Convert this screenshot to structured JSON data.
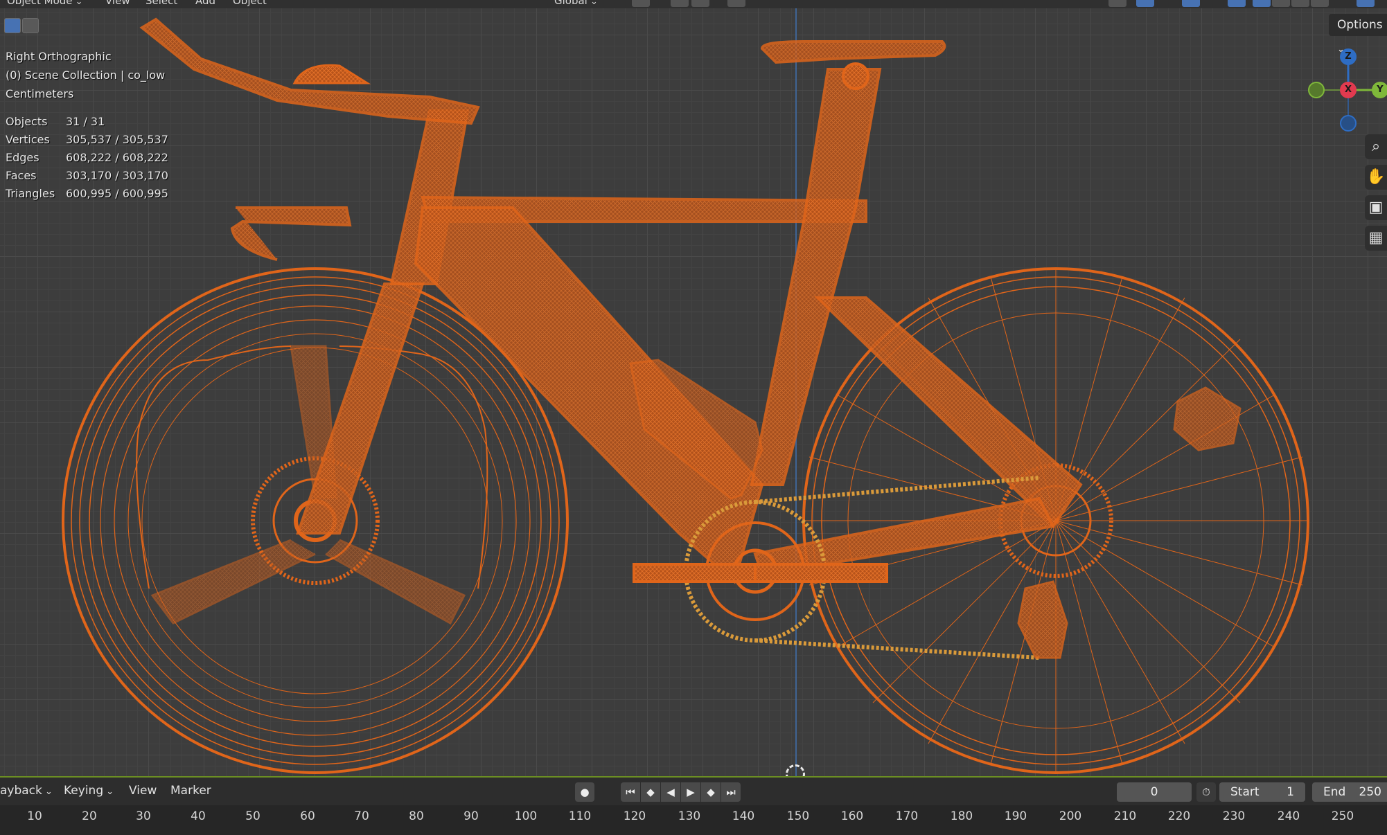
{
  "header": {
    "mode": "Object Mode",
    "menus": [
      "View",
      "Select",
      "Add",
      "Object"
    ],
    "transform_orientation": "Global"
  },
  "overlay": {
    "view_name": "Right Orthographic",
    "collection": "(0) Scene Collection | co_low",
    "units": "Centimeters",
    "stats": [
      {
        "label": "Objects",
        "value": "31 / 31"
      },
      {
        "label": "Vertices",
        "value": "305,537 / 305,537"
      },
      {
        "label": "Edges",
        "value": "608,222 / 608,222"
      },
      {
        "label": "Faces",
        "value": "303,170 / 303,170"
      },
      {
        "label": "Triangles",
        "value": "600,995 / 600,995"
      }
    ]
  },
  "options_label": "Options",
  "gizmo": {
    "z": "Z",
    "x": "X",
    "y": "Y"
  },
  "colors": {
    "wire": "#e0651a",
    "wire_dark": "#b94a0c",
    "axis_z": "#2e6dc4",
    "axis_x": "#e23a4f",
    "axis_y": "#7fb83a",
    "timeline_accent": "#6b8e23"
  },
  "timeline": {
    "playback": "ayback",
    "keying": "Keying",
    "view": "View",
    "marker": "Marker",
    "current_frame": "0",
    "start_label": "Start",
    "start_value": "1",
    "end_label": "End",
    "end_value": "250",
    "ticks": [
      "10",
      "20",
      "30",
      "40",
      "50",
      "60",
      "70",
      "80",
      "90",
      "100",
      "110",
      "120",
      "130",
      "140",
      "150",
      "160",
      "170",
      "180",
      "190",
      "200",
      "210",
      "220",
      "230",
      "240",
      "250"
    ]
  }
}
